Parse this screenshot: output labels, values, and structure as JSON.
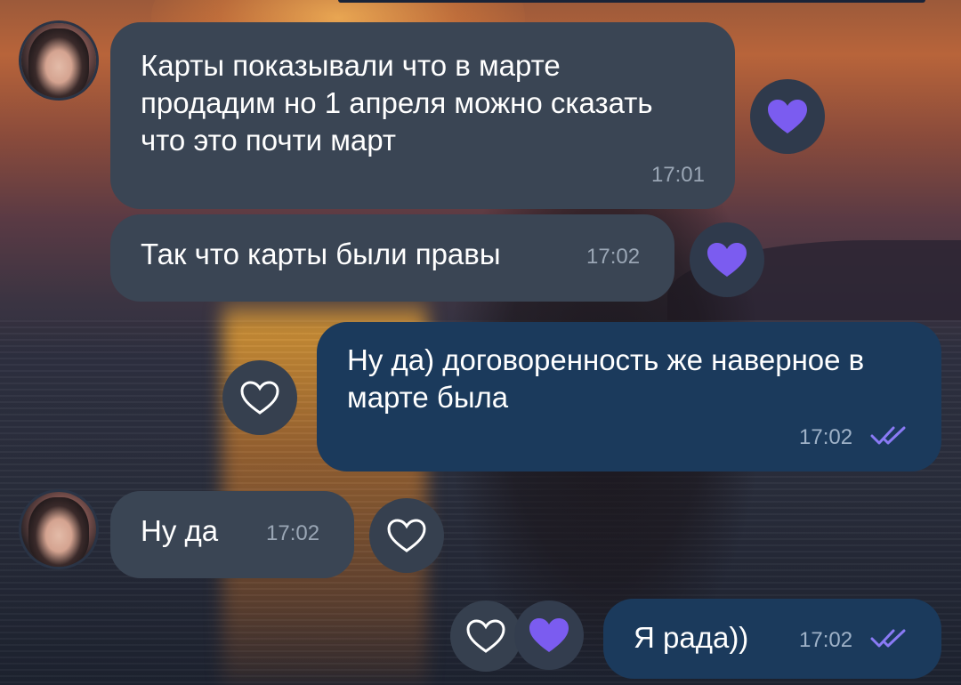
{
  "messages": [
    {
      "text": "Карты показывали что в марте продадим но 1 апреля можно сказать что это почти март",
      "time": "17:01"
    },
    {
      "text": "Так что карты были правы",
      "time": "17:02"
    },
    {
      "text": "Ну да) договоренность же наверное в марте была",
      "time": "17:02"
    },
    {
      "text": "Ну да",
      "time": "17:02"
    },
    {
      "text": "Я рада))",
      "time": "17:02"
    }
  ],
  "colors": {
    "incoming_bubble": "#3a4554",
    "outgoing_bubble": "#1b3a5c",
    "heart_purple": "#7b5cf0",
    "read_ticks": "#8a7af5"
  },
  "icons": [
    "heart-filled-icon",
    "heart-outline-icon",
    "double-check-icon"
  ]
}
